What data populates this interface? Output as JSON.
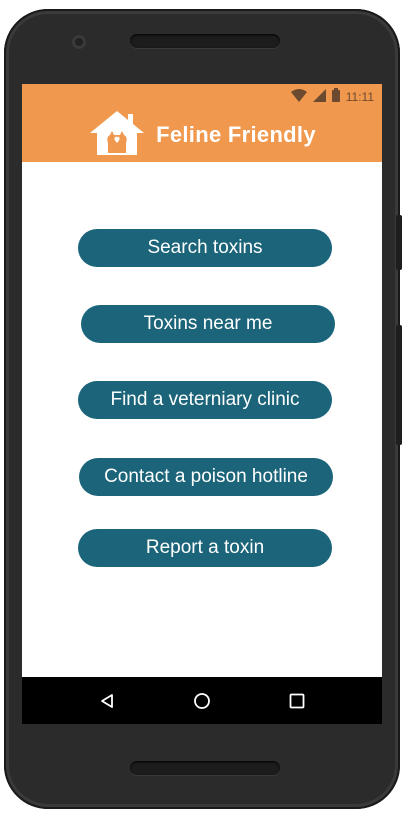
{
  "status_bar": {
    "time": "11:11",
    "icons": [
      "wifi-icon",
      "signal-icon",
      "battery-icon"
    ]
  },
  "header": {
    "app_name": "Feline Friendly",
    "logo_icon": "house-cat-heart-icon",
    "background_color": "#f0984d"
  },
  "menu": {
    "button_color": "#1b6479",
    "items": [
      {
        "label": "Search toxins"
      },
      {
        "label": "Toxins near me"
      },
      {
        "label": "Find a veterniary clinic"
      },
      {
        "label": "Contact a poison hotline"
      },
      {
        "label": "Report a toxin"
      }
    ]
  },
  "nav_bar": {
    "buttons": [
      "back-icon",
      "home-icon",
      "recents-icon"
    ]
  }
}
